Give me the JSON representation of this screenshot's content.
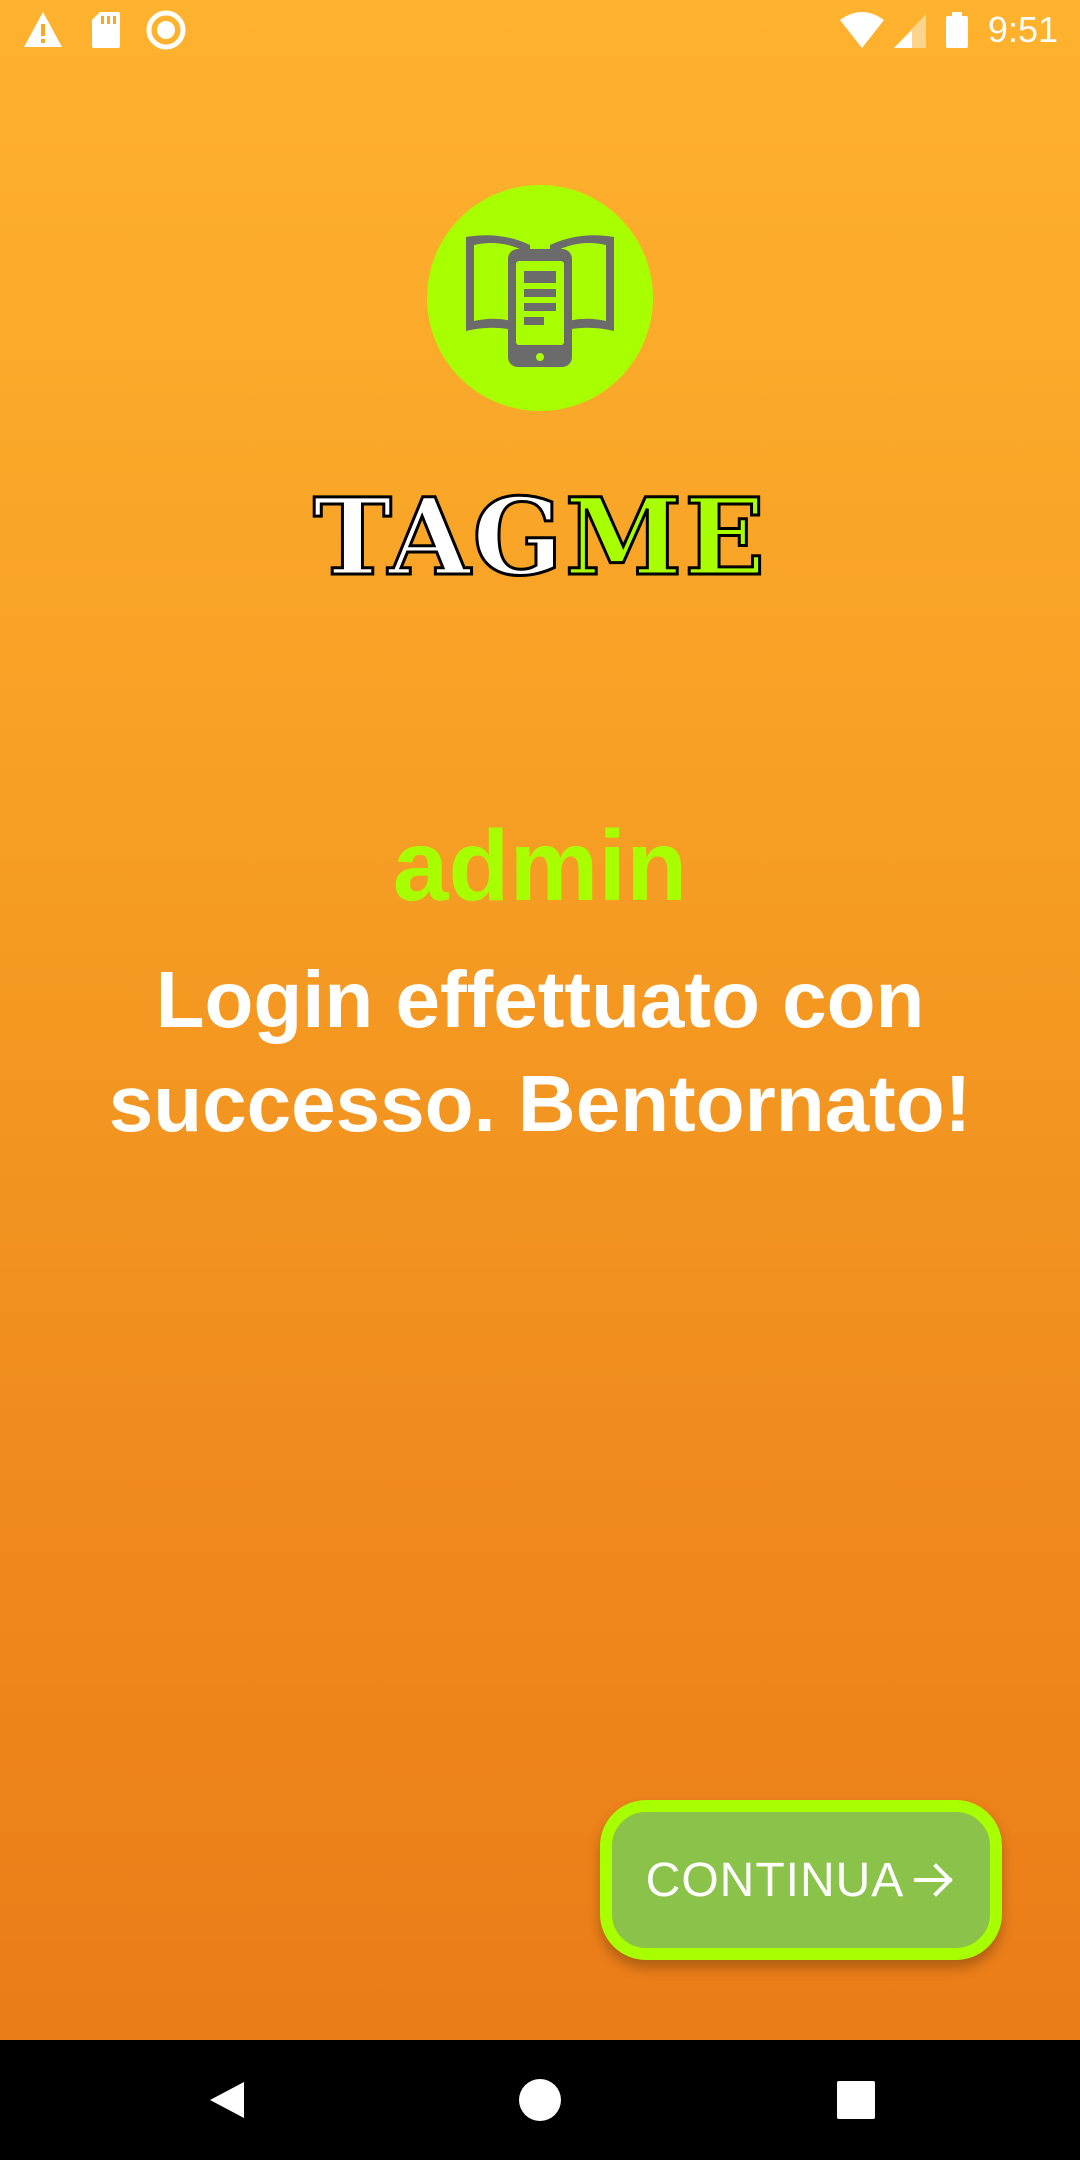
{
  "status_bar": {
    "time": "9:51",
    "left_icons": [
      "warning-icon",
      "sd-card-icon",
      "record-icon"
    ],
    "right_icons": [
      "wifi-icon",
      "signal-icon",
      "battery-icon"
    ]
  },
  "logo": {
    "icon": "book-phone-icon",
    "circle_color": "#A8FF00"
  },
  "brand": {
    "part1": "TAG",
    "part2": "ME"
  },
  "username": "admin",
  "message": "Login effettuato con successo. Bentornato!",
  "continue_button": {
    "label": "CONTINUA",
    "icon": "arrow-right-icon"
  },
  "nav_bar": {
    "buttons": [
      "back-icon",
      "home-icon",
      "recents-icon"
    ]
  },
  "colors": {
    "accent": "#A8FF00",
    "background_top": "#FFB22D",
    "background_bottom": "#EA7C18",
    "button_fill": "#8BC34A"
  }
}
